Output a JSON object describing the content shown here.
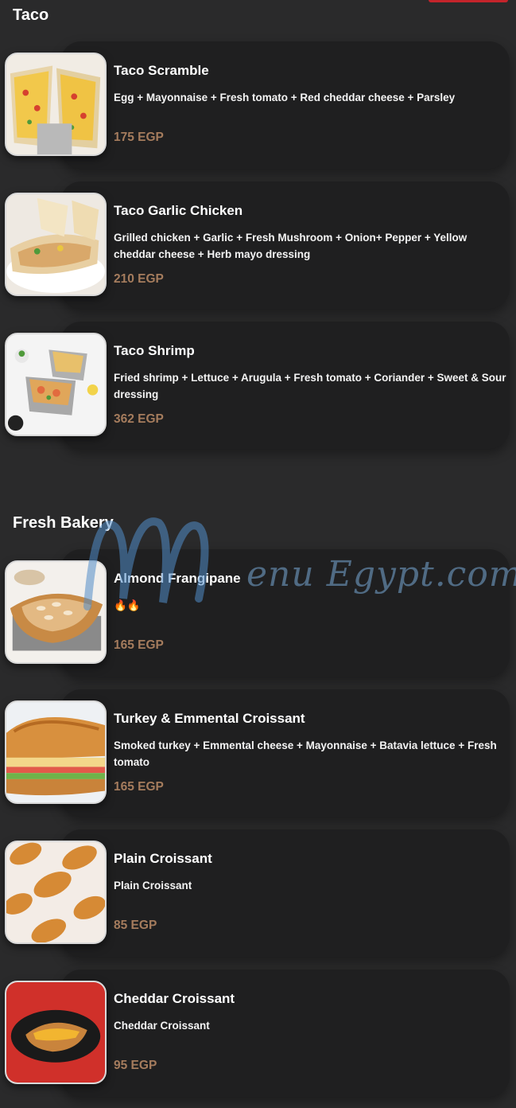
{
  "sections": [
    {
      "title": "Taco",
      "items": [
        {
          "name": "Taco Scramble",
          "desc": "Egg + Mayonnaise + Fresh tomato + Red cheddar cheese + Parsley",
          "price": "175 EGP"
        },
        {
          "name": "Taco Garlic Chicken",
          "desc": "Grilled chicken + Garlic + Fresh Mushroom + Onion+ Pepper + Yellow cheddar cheese + Herb mayo dressing",
          "price": "210 EGP"
        },
        {
          "name": "Taco Shrimp",
          "desc": "Fried shrimp + Lettuce + Arugula + Fresh tomato + Coriander + Sweet & Sour dressing",
          "price": "362 EGP"
        }
      ]
    },
    {
      "title": "Fresh Bakery",
      "items": [
        {
          "name": "Almond Frangipane",
          "desc": "🔥🔥",
          "price": "165 EGP"
        },
        {
          "name": "Turkey & Emmental Croissant",
          "desc": "Smoked turkey + Emmental cheese + Mayonnaise + Batavia lettuce + Fresh tomato",
          "price": "165 EGP"
        },
        {
          "name": "Plain Croissant",
          "desc": "Plain Croissant",
          "price": "85 EGP"
        },
        {
          "name": "Cheddar Croissant",
          "desc": "Cheddar Croissant",
          "price": "95 EGP"
        }
      ]
    }
  ],
  "watermark": {
    "text": "enu Egypt.com"
  },
  "colors": {
    "background": "#2a2a2b",
    "card": "#1f1f20",
    "price": "#a57c5d",
    "accent": "#c4242b"
  }
}
